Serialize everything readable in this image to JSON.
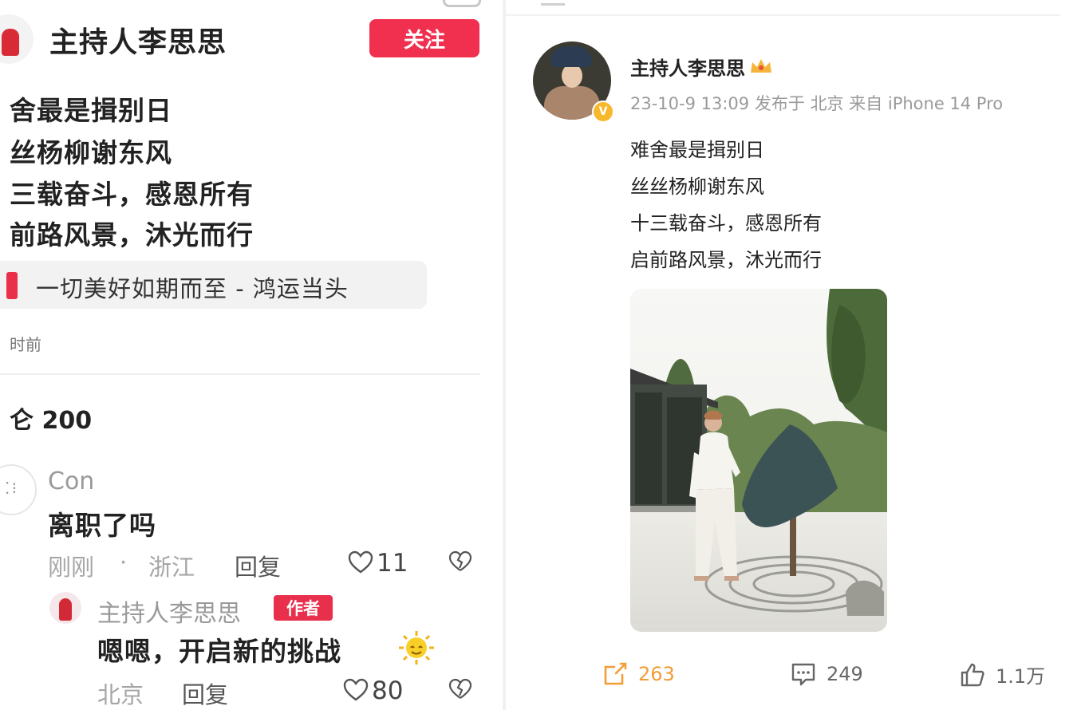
{
  "left": {
    "username": "主持人李思思",
    "follow_label": "关注",
    "poem": [
      "舍最是揖别日",
      "丝杨柳谢东风",
      "三载奋斗，感恩所有",
      "前路风景，沐光而行"
    ],
    "topic": "一切美好如期而至 - 鸿运当头",
    "time": "时前",
    "comment_count": "仑 200",
    "comment": {
      "user": "Con",
      "text": "离职了吗",
      "time": "刚刚",
      "sep": "·",
      "location": "浙江",
      "reply": "回复",
      "likes": "11"
    },
    "author_reply": {
      "user": "主持人李思思",
      "badge": "作者",
      "text": "嗯嗯，开启新的挑战",
      "location": "北京",
      "reply": "回复",
      "likes": "80"
    }
  },
  "right": {
    "username": "主持人李思思",
    "meta": "23-10-9 13:09 发布于 北京 来自 iPhone 14 Pro",
    "lines": [
      "难舍最是揖别日",
      "丝丝杨柳谢东风",
      "十三载奋斗，感恩所有",
      "启前路风景，沐光而行"
    ],
    "reposts": "263",
    "comments": "249",
    "likes": "1.1万"
  },
  "colors": {
    "accent_red": "#f0304e",
    "repost_orange": "#f29d35",
    "verified_gold": "#f7b82c"
  },
  "icons": [
    "heart-icon",
    "broken-heart-icon",
    "repost-icon",
    "comment-icon",
    "thumbs-up-icon",
    "crown-icon",
    "sun-emoji-icon",
    "verified-icon"
  ]
}
